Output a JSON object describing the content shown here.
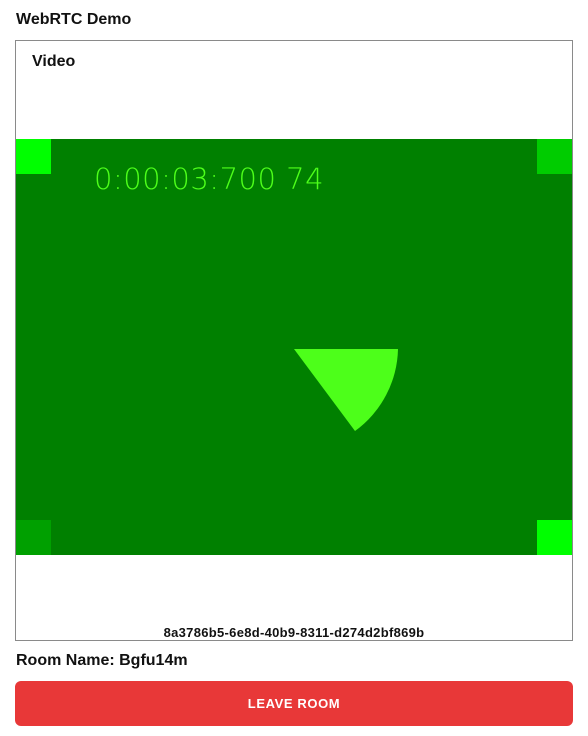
{
  "app": {
    "title": "WebRTC Demo"
  },
  "video_panel": {
    "heading": "Video",
    "timestamp": "0:00:03:700 74",
    "participant_id": "8a3786b5-6e8d-40b9-8311-d274d2bf869b",
    "colors": {
      "background": "#008000",
      "indicator": "#4dff1a"
    }
  },
  "room": {
    "label": "Room Name: Bgfu14m"
  },
  "actions": {
    "leave_label": "LEAVE ROOM",
    "leave_color": "#e83838"
  }
}
